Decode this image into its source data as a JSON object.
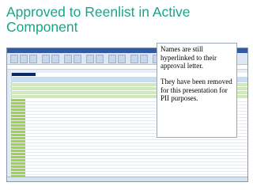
{
  "slide": {
    "title": "Approved to Reenlist in Active Component"
  },
  "callout": {
    "paragraph1": "Names are still hyperlinked to their approval letter.",
    "paragraph2": "They have been removed for this presentation for PII purposes."
  }
}
